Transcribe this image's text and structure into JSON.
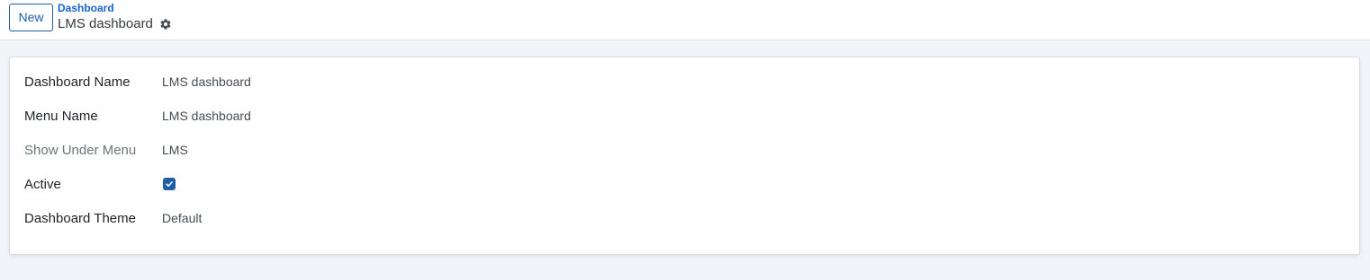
{
  "control_panel": {
    "new_button_label": "New",
    "breadcrumb": "Dashboard",
    "record_title": "LMS dashboard",
    "settings_icon": "gear-icon"
  },
  "form": {
    "fields": [
      {
        "label": "Dashboard Name",
        "value": "LMS dashboard"
      },
      {
        "label": "Menu Name",
        "value": "LMS dashboard"
      },
      {
        "label": "Show Under Menu",
        "value": "LMS"
      },
      {
        "label": "Active",
        "checked": true
      },
      {
        "label": "Dashboard Theme",
        "value": "Default"
      }
    ]
  },
  "colors": {
    "primary": "#1f5fa6",
    "link": "#1a64c8",
    "background": "#f1f4f8"
  }
}
